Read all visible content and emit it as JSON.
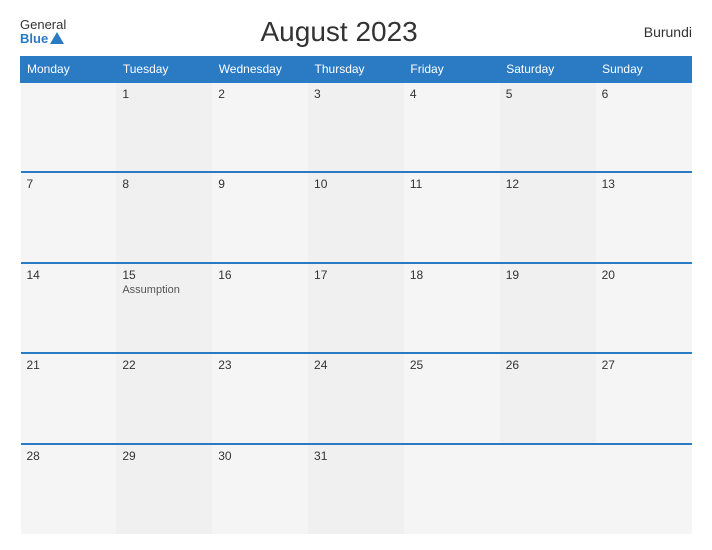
{
  "header": {
    "logo_general": "General",
    "logo_blue": "Blue",
    "title": "August 2023",
    "country": "Burundi"
  },
  "days_of_week": [
    "Monday",
    "Tuesday",
    "Wednesday",
    "Thursday",
    "Friday",
    "Saturday",
    "Sunday"
  ],
  "weeks": [
    [
      {
        "day": "",
        "event": ""
      },
      {
        "day": "1",
        "event": ""
      },
      {
        "day": "2",
        "event": ""
      },
      {
        "day": "3",
        "event": ""
      },
      {
        "day": "4",
        "event": ""
      },
      {
        "day": "5",
        "event": ""
      },
      {
        "day": "6",
        "event": ""
      }
    ],
    [
      {
        "day": "7",
        "event": ""
      },
      {
        "day": "8",
        "event": ""
      },
      {
        "day": "9",
        "event": ""
      },
      {
        "day": "10",
        "event": ""
      },
      {
        "day": "11",
        "event": ""
      },
      {
        "day": "12",
        "event": ""
      },
      {
        "day": "13",
        "event": ""
      }
    ],
    [
      {
        "day": "14",
        "event": ""
      },
      {
        "day": "15",
        "event": "Assumption"
      },
      {
        "day": "16",
        "event": ""
      },
      {
        "day": "17",
        "event": ""
      },
      {
        "day": "18",
        "event": ""
      },
      {
        "day": "19",
        "event": ""
      },
      {
        "day": "20",
        "event": ""
      }
    ],
    [
      {
        "day": "21",
        "event": ""
      },
      {
        "day": "22",
        "event": ""
      },
      {
        "day": "23",
        "event": ""
      },
      {
        "day": "24",
        "event": ""
      },
      {
        "day": "25",
        "event": ""
      },
      {
        "day": "26",
        "event": ""
      },
      {
        "day": "27",
        "event": ""
      }
    ],
    [
      {
        "day": "28",
        "event": ""
      },
      {
        "day": "29",
        "event": ""
      },
      {
        "day": "30",
        "event": ""
      },
      {
        "day": "31",
        "event": ""
      },
      {
        "day": "",
        "event": ""
      },
      {
        "day": "",
        "event": ""
      },
      {
        "day": "",
        "event": ""
      }
    ]
  ]
}
